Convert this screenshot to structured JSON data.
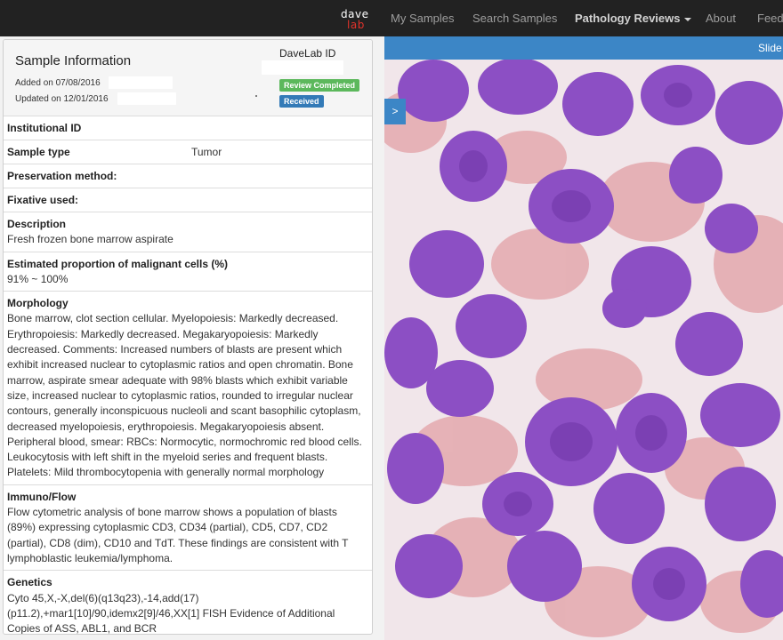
{
  "navbar": {
    "logo_line1": "dave",
    "logo_line2": "lab",
    "items": [
      {
        "label": "My Samples"
      },
      {
        "label": "Search Samples"
      },
      {
        "label": "Pathology Reviews"
      },
      {
        "label": "About"
      },
      {
        "label": "Feedback"
      }
    ]
  },
  "sample": {
    "title": "Sample Information",
    "added": "Added on 07/08/2016",
    "updated": "Updated on 12/01/2016",
    "davelab_id_label": "DaveLab ID",
    "badge_review": "Review Completed",
    "badge_received": "Received"
  },
  "fields": {
    "institutional_id": {
      "label": "Institutional ID",
      "value": ""
    },
    "sample_type": {
      "label": "Sample type",
      "value": "Tumor"
    },
    "preservation": {
      "label": "Preservation method:",
      "value": ""
    },
    "fixative": {
      "label": "Fixative used:",
      "value": ""
    },
    "description": {
      "label": "Description",
      "value": "Fresh frozen bone marrow aspirate"
    },
    "proportion": {
      "label": "Estimated proportion of malignant cells (%)",
      "value": "91% ~ 100%"
    },
    "morphology": {
      "label": "Morphology",
      "value": "Bone marrow, clot section cellular. Myelopoiesis: Markedly decreased. Erythropoiesis: Markedly decreased. Megakaryopoiesis: Markedly decreased. Comments: Increased numbers of blasts are present which exhibit increased nuclear to cytoplasmic ratios and open chromatin. Bone marrow, aspirate smear adequate with 98% blasts which exhibit variable size, increased nuclear to cytoplasmic ratios, rounded to irregular nuclear contours, generally inconspicuous nucleoli and scant basophilic cytoplasm, decreased myelopoiesis, erythropoiesis. Megakaryopoiesis absent. Peripheral blood, smear: RBCs: Normocytic, normochromic red blood cells. Leukocytosis with left shift in the myeloid series and frequent blasts. Platelets: Mild thrombocytopenia with generally normal morphology"
    },
    "immuno": {
      "label": "Immuno/Flow",
      "value": "Flow cytometric analysis of bone marrow shows a population of blasts (89%) expressing cytoplasmic CD3, CD34 (partial), CD5, CD7, CD2 (partial), CD8 (dim), CD10 and TdT. These findings are consistent with T lymphoblastic leukemia/lymphoma."
    },
    "genetics": {
      "label": "Genetics",
      "value": "Cyto 45,X,-X,del(6)(q13q23),-14,add(17)(p11.2),+mar1[10]/90,idemx2[9]/46,XX[1] FISH Evidence of Additional Copies of ASS, ABL1, and BCR"
    }
  },
  "viewer": {
    "slide_label": "Slide",
    "toggle_label": ">"
  },
  "colors": {
    "navbar_bg": "#222222",
    "accent_blue": "#3c86c6",
    "badge_green": "#5cb85c",
    "badge_blue": "#337ab7",
    "cell_purple": "#8c4fc4",
    "rbc_pink": "#e4a8ae"
  }
}
